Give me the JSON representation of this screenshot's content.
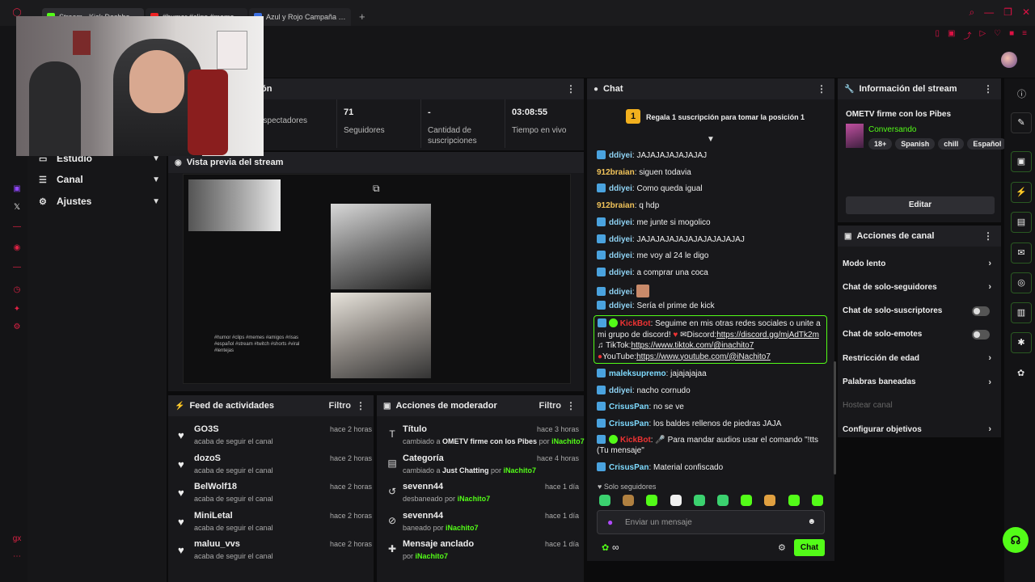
{
  "browser": {
    "tabs": [
      {
        "label": "Stream - Kick Dashboard",
        "color": "#53fc18"
      },
      {
        "label": "#humor #clips #memes #",
        "color": "#e22"
      },
      {
        "label": "Azul y Rojo Campaña Pó",
        "color": "#3b6fe0"
      }
    ],
    "new_tab": "+"
  },
  "sidebar": {
    "items": [
      {
        "label": "Estudio",
        "icon": "studio-icon"
      },
      {
        "label": "Canal",
        "icon": "channel-icon"
      },
      {
        "label": "Ajustes",
        "icon": "gear-icon"
      }
    ]
  },
  "stats": {
    "title_partial": "ión",
    "items": [
      {
        "value": "",
        "label": "espectadores"
      },
      {
        "value": "71",
        "label": "Seguidores"
      },
      {
        "value": "-",
        "label": "Cantidad de suscripciones"
      },
      {
        "value": "03:08:55",
        "label": "Tiempo en vivo"
      }
    ]
  },
  "preview": {
    "title": "Vista previa del stream"
  },
  "feed": {
    "title": "Feed de actividades",
    "filter": "Filtro",
    "items": [
      {
        "name": "GO3S",
        "sub": "acaba de seguir el canal",
        "time": "hace 2 horas"
      },
      {
        "name": "dozoS",
        "sub": "acaba de seguir el canal",
        "time": "hace 2 horas"
      },
      {
        "name": "BelWolf18",
        "sub": "acaba de seguir el canal",
        "time": "hace 2 horas"
      },
      {
        "name": "MiniLetal",
        "sub": "acaba de seguir el canal",
        "time": "hace 2 horas"
      },
      {
        "name": "maluu_vvs",
        "sub": "acaba de seguir el canal",
        "time": "hace 2 horas"
      }
    ]
  },
  "mod": {
    "title": "Acciones de moderador",
    "filter": "Filtro",
    "items": [
      {
        "name": "Título",
        "pre": "cambiado a ",
        "obj": "OMETV firme con los Pibes",
        "by": " por ",
        "user": "iNachito7",
        "time": "hace 3 horas",
        "icon": "title-icon"
      },
      {
        "name": "Categoría",
        "pre": "cambiado a ",
        "obj": "Just Chatting",
        "by": " por ",
        "user": "iNachito7",
        "time": "hace 4 horas",
        "icon": "category-icon"
      },
      {
        "name": "sevenn44",
        "pre": "desbaneado por ",
        "obj": "",
        "by": "",
        "user": "iNachito7",
        "time": "hace 1 día",
        "icon": "unban-icon"
      },
      {
        "name": "sevenn44",
        "pre": "baneado por ",
        "obj": "",
        "by": "",
        "user": "iNachito7",
        "time": "hace 1 día",
        "icon": "ban-icon"
      },
      {
        "name": "Mensaje anclado",
        "pre": "por ",
        "obj": "",
        "by": "",
        "user": "iNachito7",
        "time": "hace 1 día",
        "icon": "pin-icon"
      }
    ]
  },
  "chat": {
    "title": "Chat",
    "promo_rank": "1",
    "promo": "Regala 1 suscripción para tomar la posición 1",
    "messages": [
      {
        "user": "ddiyei",
        "text": "JAJAJAJAJAJAJAJ",
        "badge": true,
        "cls": ""
      },
      {
        "user": "912braian",
        "text": "siguen todavia",
        "badge": false,
        "cls": "y"
      },
      {
        "user": "ddiyei",
        "text": "Como queda igual",
        "badge": true,
        "cls": ""
      },
      {
        "user": "912braian",
        "text": "q hdp",
        "badge": false,
        "cls": "y"
      },
      {
        "user": "ddiyei",
        "text": "me junte si mogolico",
        "badge": true,
        "cls": ""
      },
      {
        "user": "ddiyei",
        "text": "JAJAJAJAJAJAJAJAJAJAJAJ",
        "badge": true,
        "cls": ""
      },
      {
        "user": "ddiyei",
        "text": "me voy al 24 le digo",
        "badge": true,
        "cls": ""
      },
      {
        "user": "ddiyei",
        "text": "a comprar una coca",
        "badge": true,
        "cls": ""
      },
      {
        "user": "ddiyei",
        "text": "",
        "badge": true,
        "cls": ""
      },
      {
        "user": "ddiyei",
        "text": "Sería el prime de kick",
        "badge": true,
        "cls": ""
      }
    ],
    "bot": {
      "user": "KickBot",
      "text1": "Seguime en mis otras redes sociales o unite a mi grupo de discord! ",
      "discord_label": "Discord:",
      "discord_url": "https://discord.gg/mjAdTk2m",
      "tiktok_label": "TikTok:",
      "tiktok_url": "https://www.tiktok.com/@inachito7",
      "youtube_label": "YouTube:",
      "youtube_url": "https://www.youtube.com/@iNachito7"
    },
    "messages2": [
      {
        "user": "maleksupremo",
        "text": "jajajajajaa",
        "badge": true,
        "cls": "g"
      },
      {
        "user": "ddiyei",
        "text": "nacho cornudo",
        "badge": true,
        "cls": ""
      },
      {
        "user": "CrisusPan",
        "text": "no se ve",
        "badge": true,
        "cls": "g"
      },
      {
        "user": "CrisusPan",
        "text": "los baldes rellenos de piedras JAJA",
        "badge": true,
        "cls": "g"
      }
    ],
    "bot2": {
      "user": "KickBot",
      "text": "🎤 Para mandar audios usar el comando \"!tts (Tu mensaje\""
    },
    "messages3": [
      {
        "user": "CrisusPan",
        "text": "Material confiscado",
        "badge": true,
        "cls": "g"
      }
    ],
    "followers_only": "Solo seguidores",
    "placeholder": "Enviar un mensaje",
    "send": "Chat"
  },
  "info": {
    "title": "Información del stream",
    "stream_title": "OMETV firme con los Pibes",
    "category": "Conversando",
    "tags": [
      "18+",
      "Spanish",
      "chill",
      "Español"
    ],
    "edit": "Editar"
  },
  "actions": {
    "title": "Acciones de canal",
    "rows": [
      {
        "label": "Modo lento",
        "type": "chev"
      },
      {
        "label": "Chat de solo-seguidores",
        "type": "chev"
      },
      {
        "label": "Chat de solo-suscriptores",
        "type": "toggle"
      },
      {
        "label": "Chat de solo-emotes",
        "type": "toggle"
      },
      {
        "label": "Restricción de edad",
        "type": "chev"
      },
      {
        "label": "Palabras baneadas",
        "type": "chev"
      },
      {
        "label": "Hostear canal",
        "type": "disabled"
      },
      {
        "label": "Configurar objetivos",
        "type": "chev"
      }
    ]
  },
  "colors": {
    "accent": "#53fc18",
    "panel": "#18181b",
    "header": "#202024",
    "opera": "#dd2244"
  }
}
